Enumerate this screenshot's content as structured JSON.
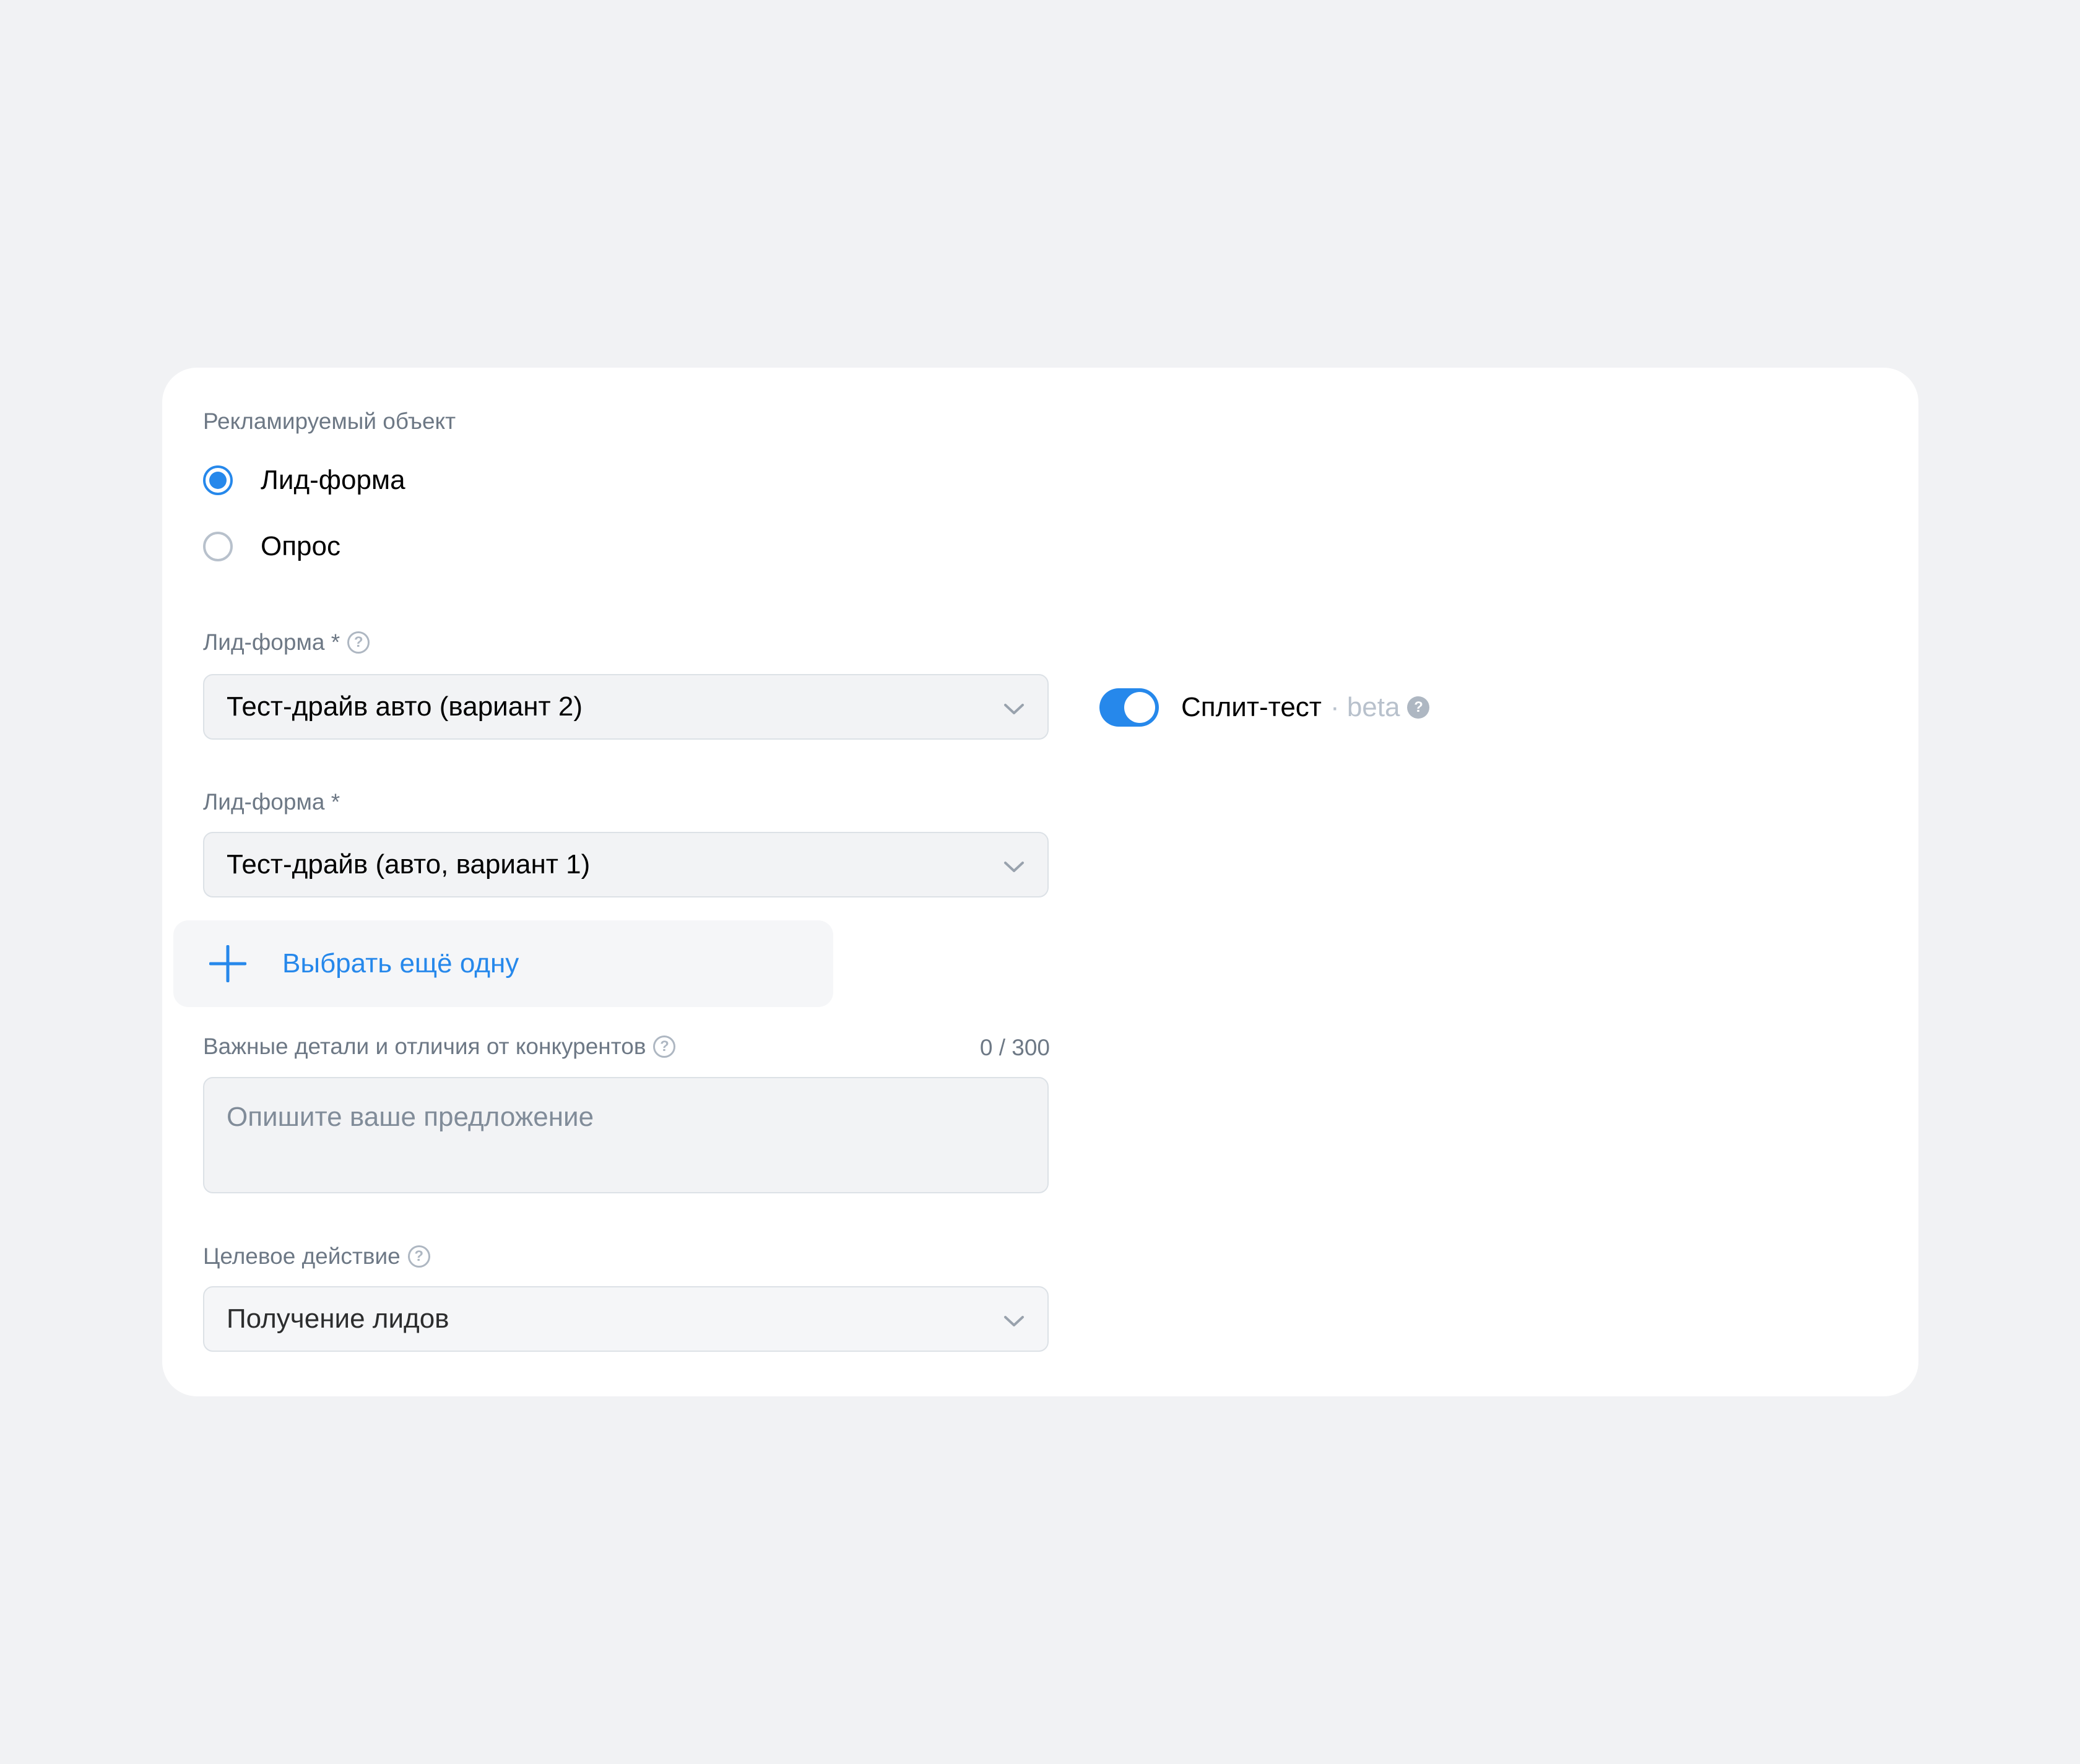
{
  "object_section": {
    "label": "Рекламируемый объект",
    "options": [
      {
        "label": "Лид-форма",
        "selected": true
      },
      {
        "label": "Опрос",
        "selected": false
      }
    ]
  },
  "lead_form_1": {
    "label": "Лид-форма *",
    "value": "Тест-драйв авто (вариант 2)"
  },
  "split_test": {
    "label": "Сплит-тест",
    "badge": "· beta",
    "enabled": true
  },
  "lead_form_2": {
    "label": "Лид-форма *",
    "value": "Тест-драйв (авто, вариант 1)"
  },
  "add_more": {
    "label": "Выбрать ещё одну"
  },
  "details": {
    "label": "Важные детали и отличия от конкурентов",
    "counter": "0 / 300",
    "placeholder": "Опишите ваше предложение"
  },
  "target_action": {
    "label": "Целевое действие",
    "value": "Получение лидов"
  },
  "icons": {
    "help": "question-circle-icon",
    "chevron": "chevron-down-icon",
    "plus": "plus-icon"
  },
  "colors": {
    "accent": "#2688eb",
    "background": "#f1f2f4",
    "card": "#ffffff",
    "secondary_text": "#6d7885"
  }
}
